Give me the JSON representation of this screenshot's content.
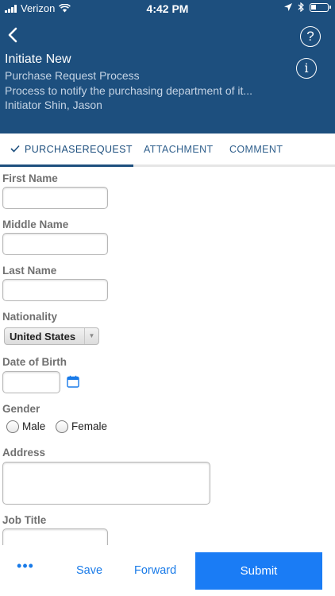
{
  "status_bar": {
    "carrier": "Verizon",
    "time": "4:42 PM"
  },
  "header": {
    "title": "Initiate New",
    "process_name": "Purchase Request Process",
    "description": "Process to notify the purchasing department of it...",
    "initiator": "Initiator Shin, Jason",
    "help_symbol": "?",
    "info_symbol": "i"
  },
  "tabs": [
    {
      "label": "PURCHASEREQUEST",
      "active": true
    },
    {
      "label": "ATTACHMENT",
      "active": false
    },
    {
      "label": "COMMENT",
      "active": false
    }
  ],
  "form": {
    "first_name": {
      "label": "First Name",
      "value": ""
    },
    "middle_name": {
      "label": "Middle Name",
      "value": ""
    },
    "last_name": {
      "label": "Last Name",
      "value": ""
    },
    "nationality": {
      "label": "Nationality",
      "selected": "United States"
    },
    "date_of_birth": {
      "label": "Date of Birth",
      "value": ""
    },
    "gender": {
      "label": "Gender",
      "options": [
        "Male",
        "Female"
      ]
    },
    "address": {
      "label": "Address",
      "value": ""
    },
    "job_title": {
      "label": "Job Title",
      "value": ""
    }
  },
  "actions": {
    "more": "•••",
    "save": "Save",
    "forward": "Forward",
    "submit": "Submit"
  },
  "colors": {
    "header_bg": "#1d4f7e",
    "accent": "#1a7cf5",
    "tab_text": "#2f5f8c"
  },
  "icons": [
    "signal-icon",
    "wifi-icon",
    "location-arrow-icon",
    "bluetooth-icon",
    "battery-icon",
    "back-chevron-icon",
    "help-icon",
    "info-icon",
    "checkmark-icon",
    "calendar-icon",
    "dropdown-arrow-icon"
  ]
}
